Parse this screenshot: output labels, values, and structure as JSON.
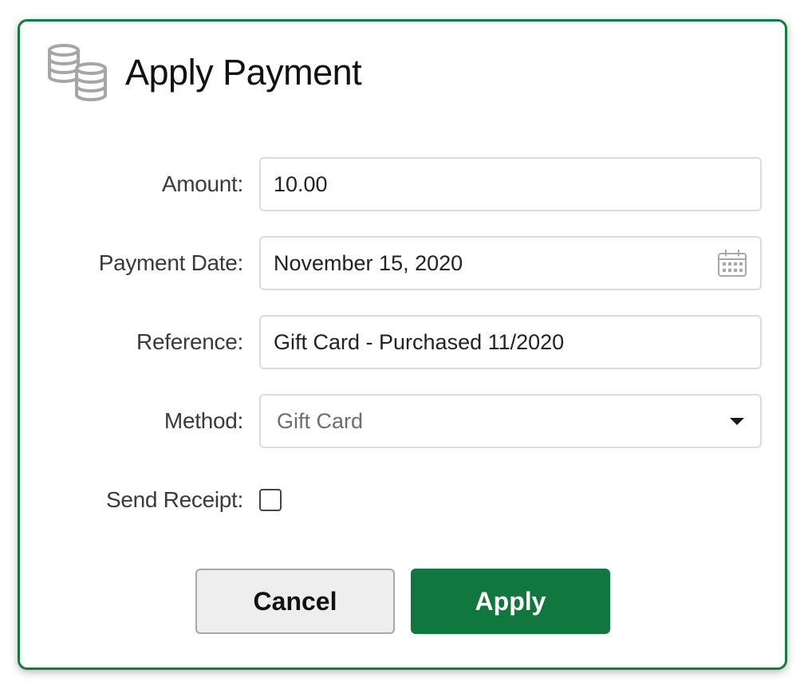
{
  "dialog": {
    "title": "Apply Payment",
    "icon": "coins-icon",
    "accent_color": "#177a42"
  },
  "form": {
    "amount": {
      "label": "Amount:",
      "value": "10.00"
    },
    "payment_date": {
      "label": "Payment Date:",
      "value": "November 15, 2020",
      "icon": "calendar-icon"
    },
    "reference": {
      "label": "Reference:",
      "value": "Gift Card - Purchased 11/2020"
    },
    "method": {
      "label": "Method:",
      "selected": "Gift Card",
      "icon": "caret-down-icon"
    },
    "send_receipt": {
      "label": "Send Receipt:",
      "checked": false
    }
  },
  "buttons": {
    "cancel_label": "Cancel",
    "apply_label": "Apply",
    "apply_color": "#10783f"
  }
}
